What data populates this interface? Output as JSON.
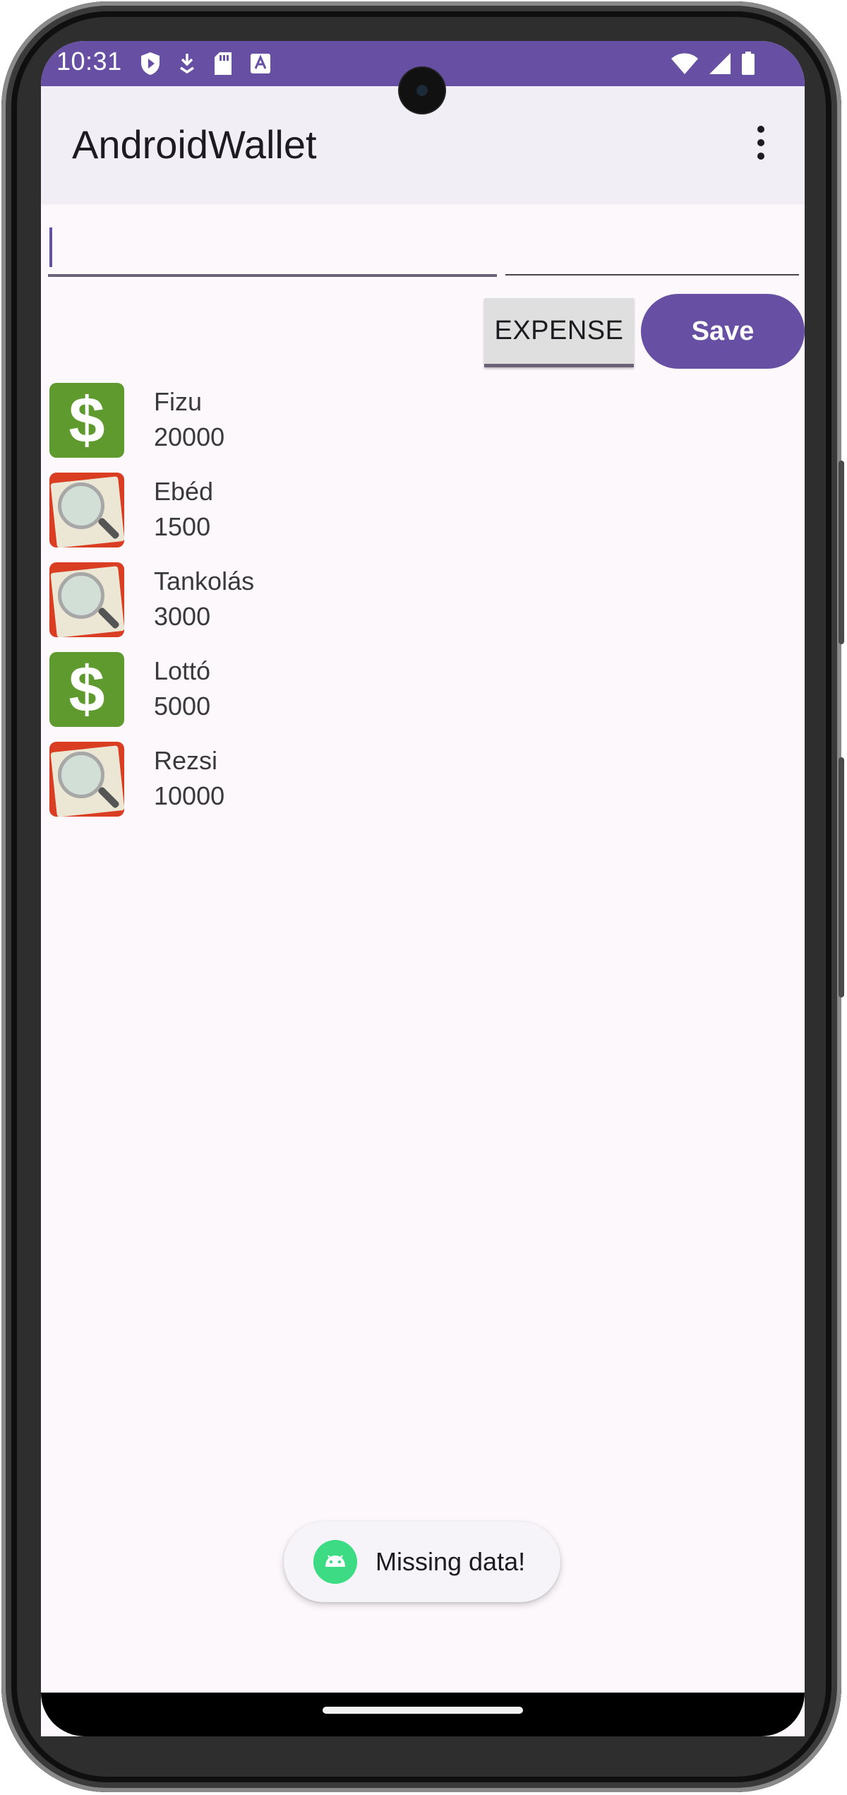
{
  "status_bar": {
    "time": "10:31",
    "left_icons": [
      "shield-play-icon",
      "download-icon",
      "sd-card-icon",
      "keyboard-a-icon"
    ],
    "right_icons": [
      "wifi-icon",
      "cell-signal-icon",
      "battery-icon"
    ]
  },
  "app_bar": {
    "title": "AndroidWallet",
    "menu_icon": "overflow-menu-icon"
  },
  "form": {
    "name_value": "",
    "amount_value": "",
    "type_toggle_label": "EXPENSE",
    "save_label": "Save"
  },
  "transactions": [
    {
      "name": "Fizu",
      "amount": "20000",
      "type": "income",
      "icon": "dollar-icon"
    },
    {
      "name": "Ebéd",
      "amount": "1500",
      "type": "expense",
      "icon": "expense-icon"
    },
    {
      "name": "Tankolás",
      "amount": "3000",
      "type": "expense",
      "icon": "expense-icon"
    },
    {
      "name": "Lottó",
      "amount": "5000",
      "type": "income",
      "icon": "dollar-icon"
    },
    {
      "name": "Rezsi",
      "amount": "10000",
      "type": "expense",
      "icon": "expense-icon"
    }
  ],
  "toast": {
    "message": "Missing data!",
    "icon": "android-icon"
  },
  "colors": {
    "primary": "#6750a4",
    "app_bar_bg": "#f1eef6",
    "background": "#fdf8fc",
    "income_icon": "#5f9a2e",
    "expense_icon": "#d93d22"
  }
}
